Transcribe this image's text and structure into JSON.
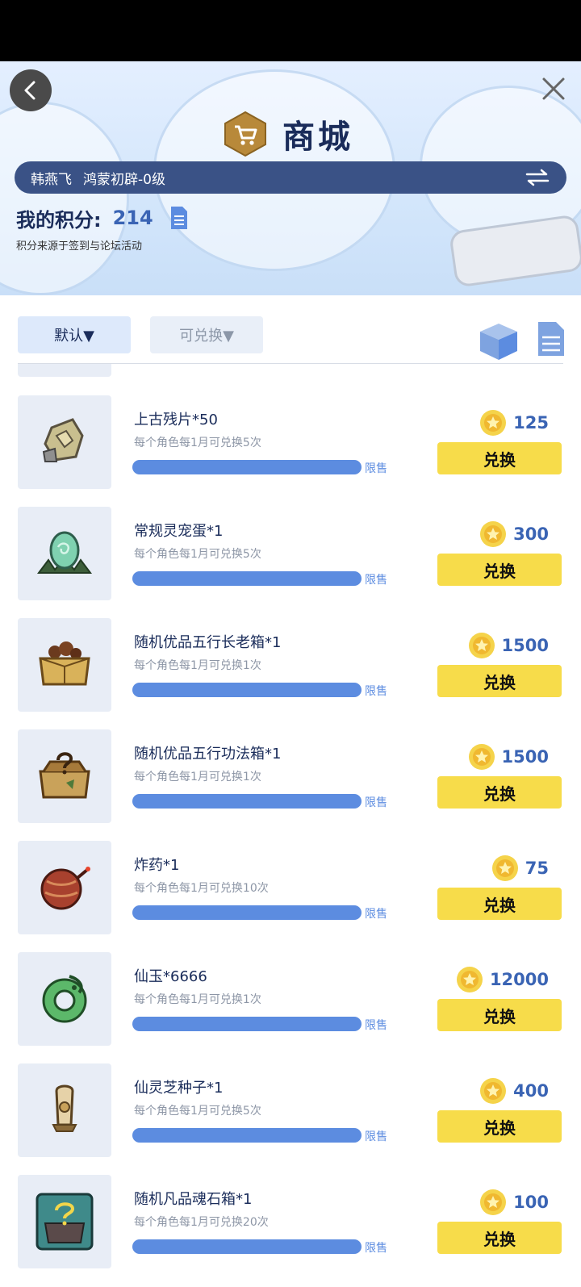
{
  "header": {
    "title": "商城",
    "user_name": "韩燕飞",
    "user_level": "鸿蒙初辟-0级",
    "points_label": "我的积分:",
    "points_value": "214",
    "points_note": "积分来源于签到与论坛活动"
  },
  "filters": {
    "default_label": "默认▼",
    "redeemable_label": "可兑换▼"
  },
  "colors": {
    "accent_blue": "#5c8ce0",
    "redeem_yellow": "#f7dc4a",
    "title_navy": "#1a2c5a"
  },
  "items": [
    {
      "name": "上古残片*50",
      "limit": "每个角色每1月可兑换5次",
      "tag": "限售",
      "price": "125",
      "button": "兑换",
      "icon": "stone-fragment-icon"
    },
    {
      "name": "常规灵宠蛋*1",
      "limit": "每个角色每1月可兑换5次",
      "tag": "限售",
      "price": "300",
      "button": "兑换",
      "icon": "pet-egg-icon"
    },
    {
      "name": "随机优品五行长老箱*1",
      "limit": "每个角色每1月可兑换1次",
      "tag": "限售",
      "price": "1500",
      "button": "兑换",
      "icon": "elder-chest-icon"
    },
    {
      "name": "随机优品五行功法箱*1",
      "limit": "每个角色每1月可兑换1次",
      "tag": "限售",
      "price": "1500",
      "button": "兑换",
      "icon": "skill-chest-icon"
    },
    {
      "name": "炸药*1",
      "limit": "每个角色每1月可兑换10次",
      "tag": "限售",
      "price": "75",
      "button": "兑换",
      "icon": "explosive-icon"
    },
    {
      "name": "仙玉*6666",
      "limit": "每个角色每1月可兑换1次",
      "tag": "限售",
      "price": "12000",
      "button": "兑换",
      "icon": "jade-icon"
    },
    {
      "name": "仙灵芝种子*1",
      "limit": "每个角色每1月可兑换5次",
      "tag": "限售",
      "price": "400",
      "button": "兑换",
      "icon": "mushroom-seed-icon"
    },
    {
      "name": "随机凡品魂石箱*1",
      "limit": "每个角色每1月可兑换20次",
      "tag": "限售",
      "price": "100",
      "button": "兑换",
      "icon": "soulstone-chest-icon"
    }
  ]
}
